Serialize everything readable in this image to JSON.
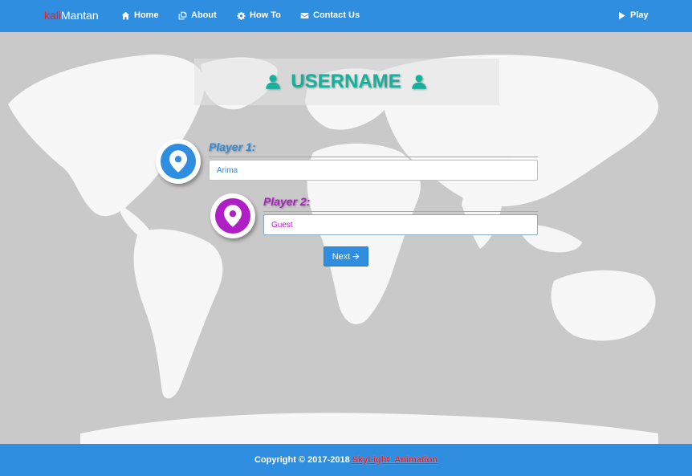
{
  "navbar": {
    "brand_accent": "kali",
    "brand_rest": "Mantan",
    "items": [
      {
        "label": "Home",
        "icon": "home-icon"
      },
      {
        "label": "About",
        "icon": "copy-icon"
      },
      {
        "label": "How To",
        "icon": "gear-icon"
      },
      {
        "label": "Contact Us",
        "icon": "envelope-icon"
      }
    ],
    "play_label": "Play",
    "play_icon": "play-icon"
  },
  "main": {
    "title": "USERNAME",
    "title_icon": "user-icon",
    "player1": {
      "label": "Player 1:",
      "value": "Arima",
      "color": "#2f8ee0",
      "icon": "map-marker-icon"
    },
    "player2": {
      "label": "Player 2:",
      "value": "Guest",
      "color": "#b01ec6",
      "icon": "map-marker-icon"
    },
    "next_label": "Next",
    "next_icon": "arrow-right-icon"
  },
  "footer": {
    "text": "Copyright © 2017-2018",
    "link_text": "SkyLight_Animation"
  },
  "colors": {
    "primary": "#2f8ee0",
    "accent": "#e3242b",
    "teal": "#14b29e",
    "purple": "#b01ec6"
  }
}
